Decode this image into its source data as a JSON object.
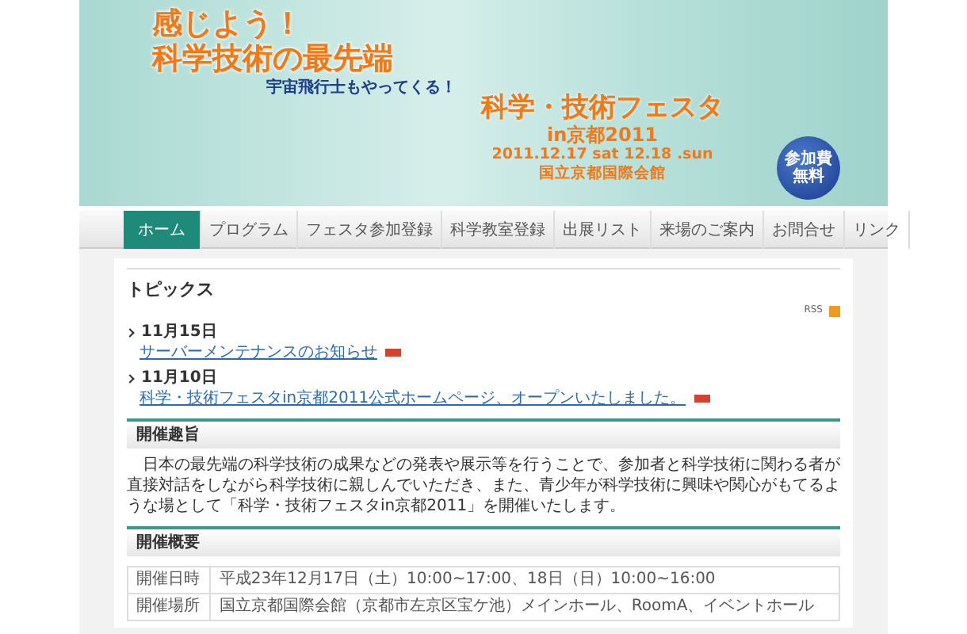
{
  "banner": {
    "headline": [
      "感じよう！",
      "科学技術の最先端"
    ],
    "tagline": "宇宙飛行士もやってくる！",
    "event_title": "科学・技術フェスタ",
    "event_subtitle": "in京都2011",
    "dates": "2011.12.17 sat 12.18 .sun",
    "venue": "国立京都国際会館",
    "fee_badge": [
      "参加費",
      "無料"
    ]
  },
  "nav": [
    {
      "label": "ホーム",
      "selected": true
    },
    {
      "label": "プログラム",
      "selected": false
    },
    {
      "label": "フェスタ参加登録",
      "selected": false
    },
    {
      "label": "科学教室登録",
      "selected": false
    },
    {
      "label": "出展リスト",
      "selected": false
    },
    {
      "label": "来場のご案内",
      "selected": false
    },
    {
      "label": "お問合せ",
      "selected": false
    },
    {
      "label": "リンク",
      "selected": false
    }
  ],
  "topics": {
    "title": "トピックス",
    "rss_label": "RSS",
    "items": [
      {
        "date": "11月15日",
        "title": "サーバーメンテナンスのお知らせ",
        "new": true
      },
      {
        "date": "11月10日",
        "title": "科学・技術フェスタin京都2011公式ホームページ、オープンいたしました。",
        "new": true
      }
    ]
  },
  "sections": [
    {
      "kind": "text",
      "title": "開催趣旨",
      "text": "日本の最先端の科学技術の成果などの発表や展示等を行うことで、参加者と科学技術に関わる者が直接対話をしながら科学技術に親しんでいただき、また、青少年が科学技術に興味や関心がもてるような場として「科学・技術フェスタin京都2011」を開催いたします。"
    },
    {
      "kind": "table",
      "title": "開催概要",
      "rows": [
        {
          "label": "開催日時",
          "value": "平成23年12月17日（土）10:00~17:00、18日（日）10:00~16:00"
        },
        {
          "label": "開催場所",
          "link": "国立京都国際会館",
          "value": "（京都市左京区宝ケ池）メインホール、RoomA、イベントホール"
        }
      ]
    }
  ]
}
